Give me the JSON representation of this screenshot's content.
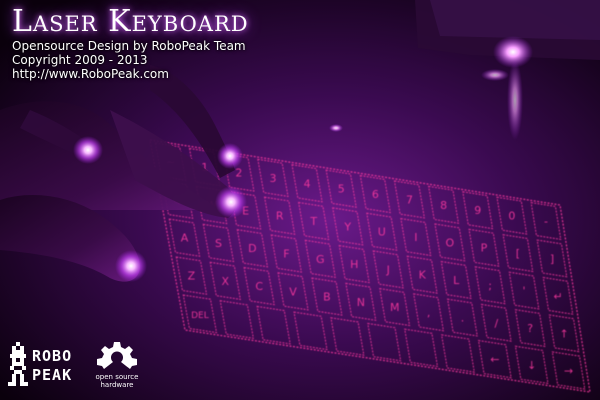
{
  "header": {
    "title": "Laser Keyboard",
    "lines": [
      "Opensource Design by RoboPeak Team",
      "Copyright 2009 - 2013",
      "http://www.RoboPeak.com"
    ]
  },
  "logos": {
    "robopeak": {
      "line1": "ROBO",
      "line2": "PEAK"
    },
    "open_source_hardware": {
      "line1": "open source",
      "line2": "hardware"
    }
  },
  "keyboard": {
    "rows": [
      [
        "~",
        "1",
        "2",
        "3",
        "4",
        "5",
        "6",
        "7",
        "8",
        "9",
        "0",
        "-"
      ],
      [
        "Q",
        "W",
        "E",
        "R",
        "T",
        "Y",
        "U",
        "I",
        "O",
        "P",
        "[",
        "]"
      ],
      [
        "A",
        "S",
        "D",
        "F",
        "G",
        "H",
        "J",
        "K",
        "L",
        ";",
        "'",
        "↵"
      ],
      [
        "Z",
        "X",
        "C",
        "V",
        "B",
        "N",
        "M",
        ",",
        ".",
        "/",
        "?",
        "↑"
      ],
      [
        "DEL",
        "",
        "",
        "",
        "",
        "",
        "",
        "",
        "←",
        "↓",
        "→"
      ]
    ]
  },
  "colors": {
    "laser": "#ff3aa0",
    "finger_glow": "#f090ff",
    "ambient": "#7a1a9a"
  }
}
